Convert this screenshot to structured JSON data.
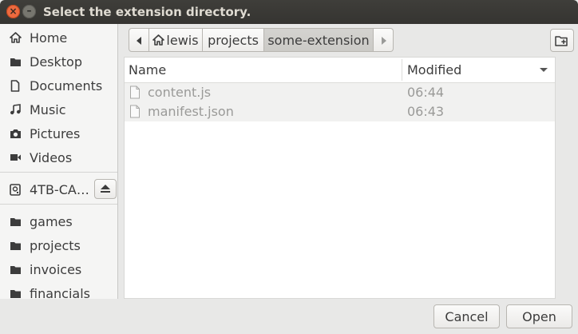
{
  "window": {
    "title": "Select the extension directory.",
    "close_glyph": "×",
    "minimize_glyph": "–"
  },
  "sidebar": {
    "places": [
      {
        "label": "Home",
        "icon": "home-icon"
      },
      {
        "label": "Desktop",
        "icon": "folder-icon"
      },
      {
        "label": "Documents",
        "icon": "document-icon"
      },
      {
        "label": "Music",
        "icon": "music-icon"
      },
      {
        "label": "Pictures",
        "icon": "camera-icon"
      },
      {
        "label": "Videos",
        "icon": "video-icon"
      }
    ],
    "devices": [
      {
        "label": "4TB-CA…",
        "icon": "drive-icon"
      }
    ],
    "bookmarks": [
      {
        "label": "games",
        "icon": "folder-icon"
      },
      {
        "label": "projects",
        "icon": "folder-icon"
      },
      {
        "label": "invoices",
        "icon": "folder-icon"
      },
      {
        "label": "financials",
        "icon": "folder-icon"
      }
    ]
  },
  "pathbar": {
    "segments": [
      "lewis",
      "projects",
      "some-extension"
    ],
    "active_index": 2
  },
  "filelist": {
    "columns": {
      "name": "Name",
      "modified": "Modified"
    },
    "sort": "descending",
    "rows": [
      {
        "name": "content.js",
        "modified": "06:44"
      },
      {
        "name": "manifest.json",
        "modified": "06:43"
      }
    ]
  },
  "actions": {
    "cancel": "Cancel",
    "open": "Open"
  }
}
